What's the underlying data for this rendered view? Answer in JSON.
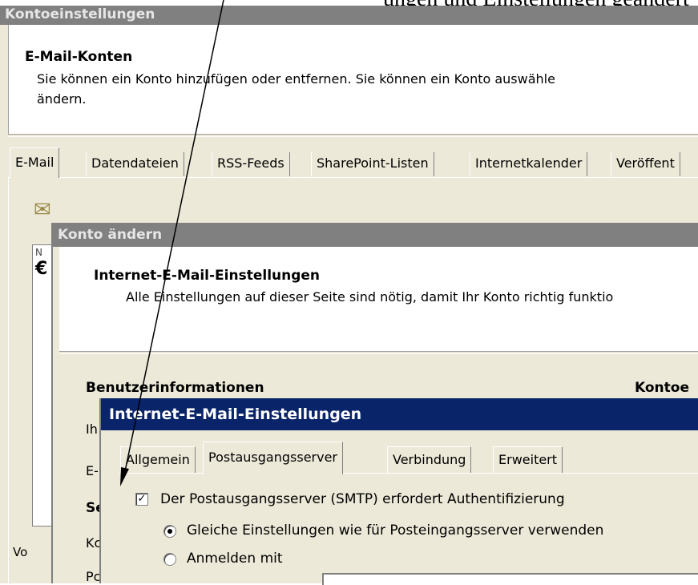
{
  "annotation": {
    "top_text": "ungen und Einstellungen geändert"
  },
  "account_settings": {
    "title": "Kontoeinstellungen",
    "heading": "E-Mail-Konten",
    "description_line1": "Sie können ein Konto hinzufügen oder entfernen. Sie können ein Konto auswähle",
    "description_line2": "ändern.",
    "tabs": [
      {
        "label": "E-Mail",
        "selected": true
      },
      {
        "label": "Datendateien"
      },
      {
        "label": "RSS-Feeds"
      },
      {
        "label": "SharePoint-Listen"
      },
      {
        "label": "Internetkalender"
      },
      {
        "label": "Veröffent"
      }
    ],
    "list_col1": "N",
    "list_col2": "€",
    "bottom_text": "Vo"
  },
  "change_account": {
    "title": "Konto ändern",
    "heading": "Internet-E-Mail-Einstellungen",
    "description": "Alle Einstellungen auf dieser Seite sind nötig, damit Ihr Konto richtig funktio",
    "section_user_info": "Benutzerinformationen",
    "section_account": "Kontoe",
    "label1": "Ih",
    "label2": "E-",
    "label3": "Se",
    "label4": "Kc",
    "label5": "Pc"
  },
  "internet_settings": {
    "title": "Internet-E-Mail-Einstellungen",
    "tabs": [
      {
        "label": "Allgemein"
      },
      {
        "label": "Postausgangsserver",
        "selected": true
      },
      {
        "label": "Verbindung"
      },
      {
        "label": "Erweitert"
      }
    ],
    "smtp_auth": {
      "label": "Der Postausgangsserver (SMTP) erfordert Authentifizierung",
      "checked": true
    },
    "radio_same": {
      "label": "Gleiche Einstellungen wie für Posteingangsserver verwenden",
      "selected": true
    },
    "radio_login": {
      "label": "Anmelden mit",
      "selected": false
    }
  }
}
